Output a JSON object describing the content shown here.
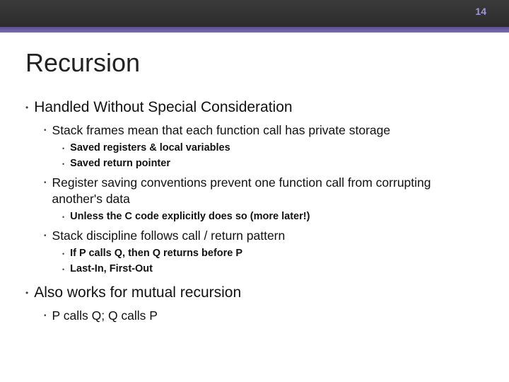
{
  "pageNumber": "14",
  "title": "Recursion",
  "bullets": [
    {
      "text": "Handled Without Special Consideration",
      "children": [
        {
          "text": "Stack frames mean that each function call has private storage",
          "children": [
            {
              "text": "Saved registers & local variables"
            },
            {
              "text": "Saved return pointer"
            }
          ]
        },
        {
          "text": "Register saving conventions prevent one function call from corrupting another's data",
          "children": [
            {
              "text": "Unless the C code explicitly does so (more later!)"
            }
          ]
        },
        {
          "text": "Stack discipline follows call / return pattern",
          "children": [
            {
              "text": "If P calls Q, then Q returns before P"
            },
            {
              "text": "Last-In, First-Out"
            }
          ]
        }
      ]
    },
    {
      "text": "Also works for mutual recursion",
      "children": [
        {
          "text": "P calls Q; Q calls P"
        }
      ]
    }
  ]
}
